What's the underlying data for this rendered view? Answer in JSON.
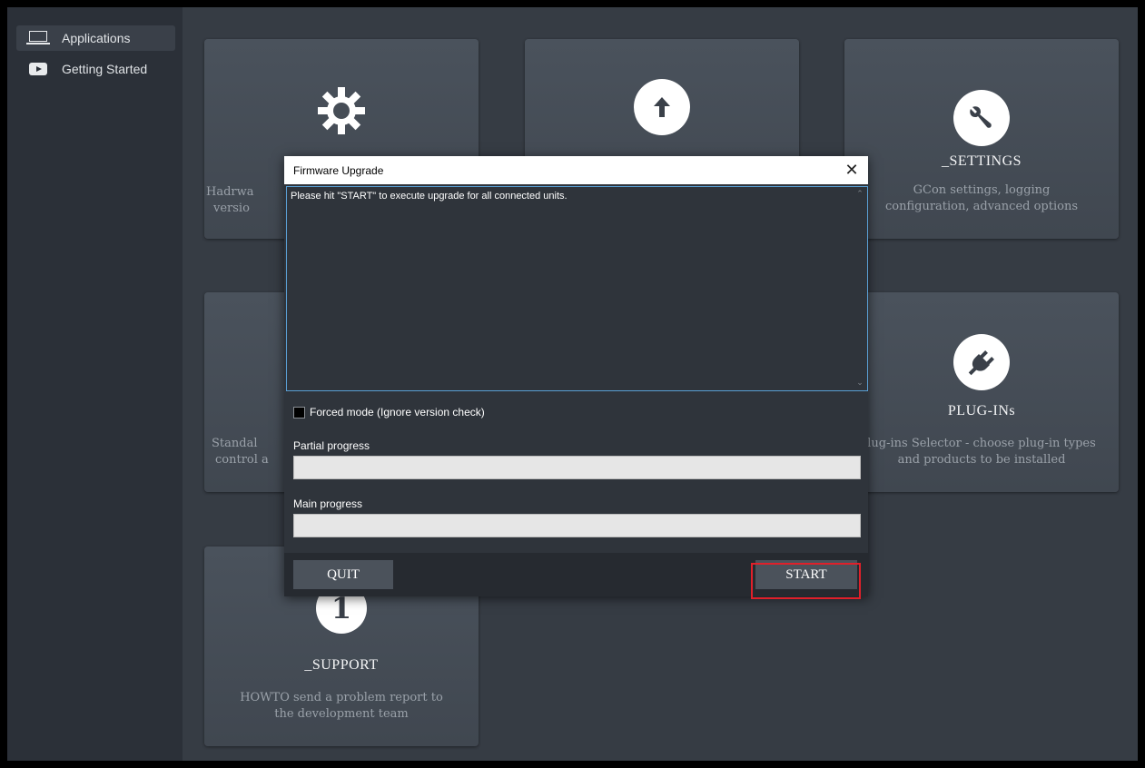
{
  "sidebar": {
    "items": [
      {
        "label": "Applications",
        "icon": "laptop-icon",
        "active": true
      },
      {
        "label": "Getting Started",
        "icon": "play-icon",
        "active": false
      }
    ]
  },
  "tiles": {
    "hardware": {
      "desc1": "Hadrwa",
      "desc2": "versio"
    },
    "upgrade": {},
    "settings": {
      "title": "_SETTINGS",
      "desc1": "GCon settings, logging",
      "desc2": "configuration, advanced options"
    },
    "standalone": {
      "desc1": "Standal",
      "desc2": "control a"
    },
    "plugins": {
      "title": "PLUG-INs",
      "desc1": "lug-ins Selector - choose plug-in types",
      "desc2": "and products to be installed"
    },
    "support": {
      "title": "_SUPPORT",
      "icon_text": "1",
      "desc1": "HOWTO send a problem report to",
      "desc2": "the development team"
    }
  },
  "dialog": {
    "title": "Firmware Upgrade",
    "close": "✕",
    "message": "Please hit \"START\" to execute upgrade for all connected units.",
    "scroll_up": "⌃",
    "scroll_down": "⌄",
    "forced_mode_label": "Forced mode (Ignore version check)",
    "forced_mode_checked": false,
    "partial_label": "Partial progress",
    "partial_value": 0,
    "main_label": "Main progress",
    "main_value": 0,
    "quit_label": "QUIT",
    "start_label": "START",
    "highlight_color": "#e0202a"
  }
}
